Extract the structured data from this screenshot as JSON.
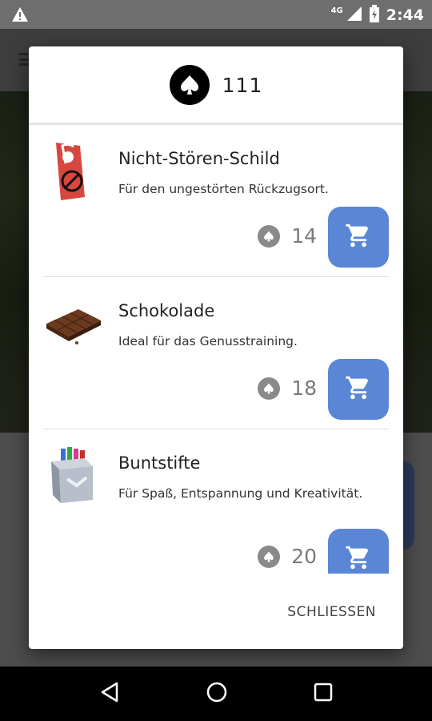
{
  "status_bar": {
    "network": "4G",
    "time": "2:44",
    "icons": [
      "warning-icon",
      "signal-icon",
      "battery-charging-icon"
    ]
  },
  "dialog": {
    "balance": "111",
    "balance_icon": "spade-coin-icon",
    "items": [
      {
        "name": "Nicht-Stören-Schild",
        "description": "Für den ungestörten Rückzugsort.",
        "price": "14",
        "icon": "door-hanger-icon"
      },
      {
        "name": "Schokolade",
        "description": "Ideal für das Genusstraining.",
        "price": "18",
        "icon": "chocolate-icon"
      },
      {
        "name": "Buntstifte",
        "description": "Für Spaß, Entspannung und Kreativität.",
        "price": "20",
        "icon": "crayons-icon"
      }
    ],
    "close_label": "SCHLIESSEN",
    "cart_icon": "cart-icon"
  },
  "nav_bar": {
    "icons": [
      "back-icon",
      "home-icon",
      "recents-icon"
    ]
  },
  "colors": {
    "accent": "#5b86d6",
    "status_bar": "#6e6e6e",
    "price_grey": "#7a7a7a"
  }
}
